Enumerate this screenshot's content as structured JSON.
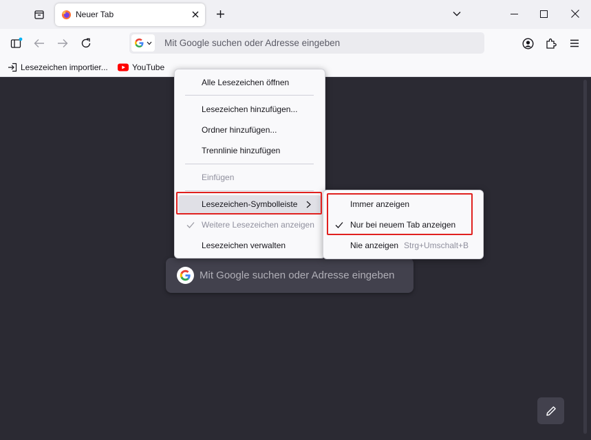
{
  "tab": {
    "title": "Neuer Tab"
  },
  "urlbar": {
    "placeholder": "Mit Google suchen oder Adresse eingeben"
  },
  "bookmarks": [
    {
      "label": "Lesezeichen importier..."
    },
    {
      "label": "YouTube"
    }
  ],
  "content": {
    "search_placeholder": "Mit Google suchen oder Adresse eingeben"
  },
  "menu": {
    "open_all": "Alle Lesezeichen öffnen",
    "add_bookmark": "Lesezeichen hinzufügen...",
    "add_folder": "Ordner hinzufügen...",
    "add_separator": "Trennlinie hinzufügen",
    "paste": "Einfügen",
    "toolbar": "Lesezeichen-Symbolleiste",
    "more_bookmarks": "Weitere Lesezeichen anzeigen",
    "manage": "Lesezeichen verwalten"
  },
  "submenu": {
    "always": "Immer anzeigen",
    "new_tab_only": "Nur bei neuem Tab anzeigen",
    "never": "Nie anzeigen",
    "never_shortcut": "Strg+Umschalt+B"
  },
  "colors": {
    "accent_red": "#e0201e",
    "content_bg": "#2b2a33",
    "panel_bg": "#42414d"
  }
}
